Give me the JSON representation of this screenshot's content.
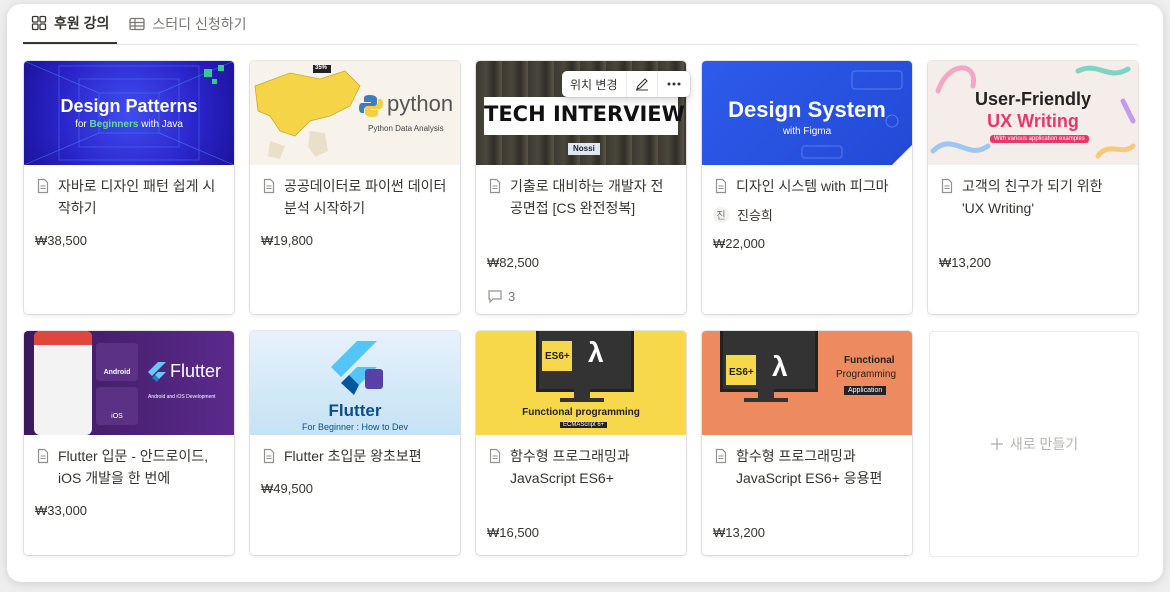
{
  "tabs": [
    {
      "label": "후원 강의",
      "icon": "gallery-icon",
      "active": true
    },
    {
      "label": "스터디 신청하기",
      "icon": "table-icon",
      "active": false
    }
  ],
  "cards": [
    {
      "title": "자바로 디자인 패턴 쉽게 시작하기",
      "price": "₩38,500",
      "cover": {
        "main": "Design Patterns",
        "sub_a": "for ",
        "sub_b": "Beginners",
        "sub_c": " with Java"
      }
    },
    {
      "title": "공공데이터로 파이썬 데이터 분석 시작하기",
      "price": "₩19,800",
      "cover": {
        "main": "python",
        "sub": "Python Data Analysis",
        "tag": "35%"
      }
    },
    {
      "title": "기출로 대비하는 개발자 전공면접 [CS 완전정복]",
      "price": "₩82,500",
      "comments": "3",
      "cover": {
        "main": "TECH INTERVIEW",
        "tag": "Nossi"
      }
    },
    {
      "title": "디자인 시스템 with 피그마",
      "price": "₩22,000",
      "person_initial": "진",
      "person": "진승희",
      "cover": {
        "main": "Design System",
        "sub": "with Figma"
      }
    },
    {
      "title": "고객의 친구가 되기 위한 'UX Writing'",
      "price": "₩13,200",
      "cover": {
        "main": "User-Friendly",
        "main2": "UX Writing",
        "sub": "With various application examples"
      }
    },
    {
      "title": "Flutter 입문 - 안드로이드, iOS 개발을 한 번에",
      "price": "₩33,000",
      "cover": {
        "main": "Flutter",
        "android": "Android",
        "ios": "iOS",
        "sub": "Android and iOS Development"
      }
    },
    {
      "title": "Flutter 초입문 왕초보편",
      "price": "₩49,500",
      "cover": {
        "main": "Flutter",
        "sub": "For Beginner : How to Dev"
      }
    },
    {
      "title": "함수형 프로그래밍과 JavaScript ES6+",
      "price": "₩16,500",
      "cover": {
        "badge": "ES6+",
        "lambda": "λ",
        "main": "Functional programming",
        "sub": "ECMAScript 6+"
      }
    },
    {
      "title": "함수형 프로그래밍과 JavaScript ES6+ 응용편",
      "price": "₩13,200",
      "cover": {
        "badge": "ES6+",
        "lambda": "λ",
        "main": "Functional",
        "main2": "Programming",
        "sub": "Application"
      }
    }
  ],
  "new_card": {
    "label": "새로 만들기"
  },
  "popover": {
    "reposition": "위치 변경",
    "edit_icon": "pencil-icon",
    "more_icon": "more-icon"
  },
  "colors": {
    "text": "#37352f",
    "muted": "#787774",
    "border": "#e9e9e7"
  }
}
